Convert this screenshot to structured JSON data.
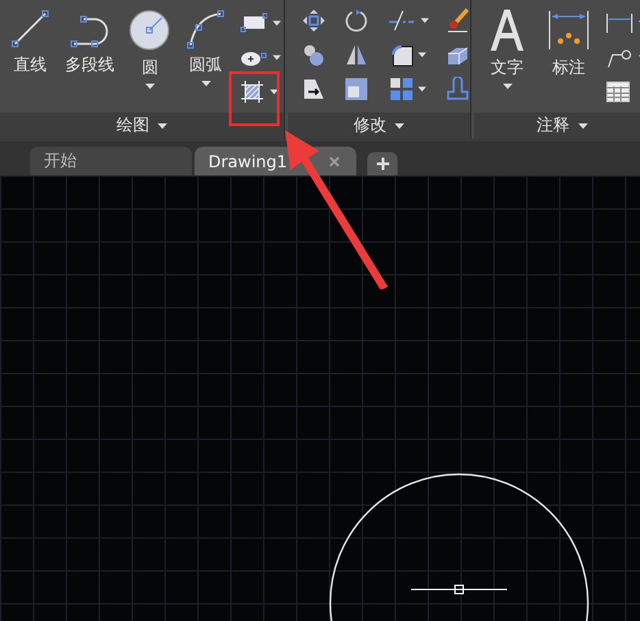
{
  "ribbon": {
    "panels": [
      {
        "kind": "draw",
        "title": "绘图",
        "tools": [
          {
            "label": "直线",
            "dropdown": false
          },
          {
            "label": "多段线",
            "dropdown": false
          },
          {
            "label": "圆",
            "dropdown": true
          },
          {
            "label": "圆弧",
            "dropdown": true
          }
        ]
      },
      {
        "kind": "modify",
        "title": "修改"
      },
      {
        "kind": "annotate",
        "title": "注释",
        "tools": [
          {
            "label": "文字",
            "dropdown": true
          },
          {
            "label": "标注",
            "dropdown": false
          }
        ]
      }
    ]
  },
  "tabs": [
    {
      "label": "开始",
      "selected": false,
      "closable": false
    },
    {
      "label": "Drawing1",
      "selected": true,
      "closable": true
    }
  ]
}
